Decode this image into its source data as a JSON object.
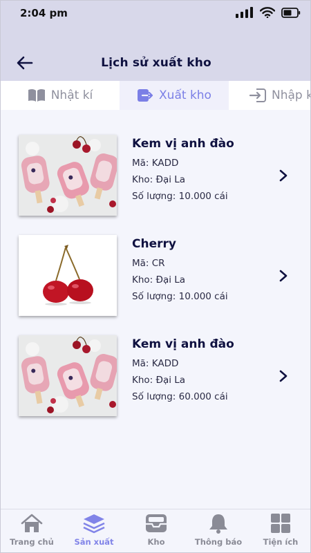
{
  "status_bar": {
    "time": "2:04 pm"
  },
  "header": {
    "title": "Lịch sử xuất kho"
  },
  "tabs": [
    {
      "label": "Nhật kí",
      "icon": "book-icon",
      "active": false
    },
    {
      "label": "Xuất kho",
      "icon": "export-icon",
      "active": true
    },
    {
      "label": "Nhập kho",
      "icon": "import-icon",
      "active": false
    }
  ],
  "items": [
    {
      "name": "Kem vị anh đào",
      "code": "Mã: KADD",
      "warehouse": "Kho: Đại La",
      "quantity": "Số lượng: 10.000 cái",
      "image": "cherry-ice-cream-image"
    },
    {
      "name": "Cherry",
      "code": "Mã: CR",
      "warehouse": "Kho: Đại La",
      "quantity": "Số lượng: 10.000 cái",
      "image": "cherry-image"
    },
    {
      "name": "Kem vị anh đào",
      "code": "Mã: KADD",
      "warehouse": "Kho: Đại La",
      "quantity": "Số lượng: 60.000 cái",
      "image": "cherry-ice-cream-image"
    }
  ],
  "bottom_nav": [
    {
      "label": "Trang chủ",
      "icon": "home-icon",
      "active": false
    },
    {
      "label": "Sản xuất",
      "icon": "layers-icon",
      "active": true
    },
    {
      "label": "Kho",
      "icon": "inbox-icon",
      "active": false
    },
    {
      "label": "Thông báo",
      "icon": "bell-icon",
      "active": false
    },
    {
      "label": "Tiện ích",
      "icon": "grid-icon",
      "active": false
    }
  ],
  "colors": {
    "header_bg": "#d8d8ea",
    "accent": "#7b7fe6",
    "nav_inactive": "#8a8b96",
    "title": "#0f1140"
  }
}
